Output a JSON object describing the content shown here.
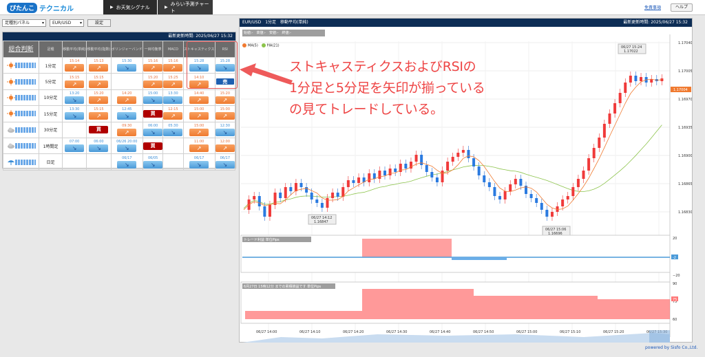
{
  "app": {
    "logo_part1": "ぴたんこ",
    "logo_part2": "テクニカル"
  },
  "nav": {
    "tab1": "お天気シグナル",
    "tab2": "みらい予測チャート",
    "disclaimer": "免責事項",
    "help": "ヘルプ"
  },
  "controls": {
    "type_select": "足種別パネル",
    "pair_select": "EUR/USD",
    "set_button": "設定"
  },
  "left_panel": {
    "updated": "最新更新時間: 2025/06/27 15:32",
    "headers": [
      "総合判断",
      "足種",
      "移動平均(単純)",
      "移動平均(指数)",
      "ボリンジャーバンド",
      "一目均衡表",
      "MACD",
      "ストキャスティクス",
      "RSI"
    ],
    "rows": [
      {
        "label": "1分足",
        "weather": "sun",
        "cells": [
          [
            "15:14",
            "up",
            "o"
          ],
          [
            "15:13",
            "up",
            "o"
          ],
          [
            "15:30",
            "dn",
            "b"
          ],
          [
            "15:16",
            "up",
            "o"
          ],
          [
            "15:16",
            "up",
            "o"
          ],
          [
            "15:28",
            "dn",
            "b"
          ],
          [
            "15:28",
            "dn",
            "b"
          ]
        ]
      },
      {
        "label": "5分足",
        "weather": "sun",
        "cells": [
          [
            "15:15",
            "up",
            "o"
          ],
          [
            "15:15",
            "up",
            "o"
          ],
          [
            "",
            "",
            ""
          ],
          [
            "15:20",
            "up",
            "o"
          ],
          [
            "15:25",
            "up",
            "o"
          ],
          [
            "14:10",
            "up",
            "o"
          ],
          [
            "",
            "sell",
            "b"
          ]
        ]
      },
      {
        "label": "10分足",
        "weather": "sun",
        "cells": [
          [
            "13:20",
            "dn",
            "b"
          ],
          [
            "15:20",
            "up",
            "o"
          ],
          [
            "14:20",
            "up",
            "o"
          ],
          [
            "15:00",
            "dn",
            "b"
          ],
          [
            "13:30",
            "dn",
            "b"
          ],
          [
            "14:40",
            "up",
            "o"
          ],
          [
            "15:20",
            "up",
            "o"
          ]
        ]
      },
      {
        "label": "15分足",
        "weather": "sun",
        "cells": [
          [
            "13:30",
            "dn",
            "b"
          ],
          [
            "15:15",
            "up",
            "o"
          ],
          [
            "12:45",
            "dn",
            "b"
          ],
          [
            "",
            "buy",
            ""
          ],
          [
            "12:15",
            "up",
            "o"
          ],
          [
            "15:00",
            "up",
            "o"
          ],
          [
            "15:00",
            "up",
            "o"
          ]
        ]
      },
      {
        "label": "30分足",
        "weather": "cloud",
        "cells": [
          [
            "",
            "",
            ""
          ],
          [
            "",
            "buy",
            ""
          ],
          [
            "09:30",
            "up",
            "o"
          ],
          [
            "06:00",
            "dn",
            "b"
          ],
          [
            "05:30",
            "dn",
            "b"
          ],
          [
            "15:00",
            "up",
            "o"
          ],
          [
            "12:30",
            "dn",
            "b"
          ]
        ]
      },
      {
        "label": "1時間足",
        "weather": "cloud",
        "cells": [
          [
            "07:00",
            "dn",
            "b"
          ],
          [
            "06:00",
            "dn",
            "b"
          ],
          [
            "06/26 20:00",
            "dn",
            "b"
          ],
          [
            "",
            "buy",
            ""
          ],
          [
            "",
            "",
            ""
          ],
          [
            "11:00",
            "up",
            "o"
          ],
          [
            "12:00",
            "up",
            "o"
          ]
        ]
      },
      {
        "label": "日足",
        "weather": "rain",
        "cells": [
          [
            "",
            "",
            ""
          ],
          [
            "",
            "",
            ""
          ],
          [
            "06/17",
            "dn",
            "b"
          ],
          [
            "06/05",
            "dn",
            "b"
          ],
          [
            "",
            "",
            ""
          ],
          [
            "06/17",
            "dn",
            "b"
          ],
          [
            "06/17",
            "dn",
            "b"
          ]
        ]
      }
    ]
  },
  "labels": {
    "buy": "買",
    "sell": "売",
    "up": "↗",
    "dn": "↘"
  },
  "chart": {
    "header": "EUR/USD　1分足　移動平均(単純)",
    "updated": "最新更新時間: 2025/06/27 15:32",
    "ohlc": "始値:-　高値:-　安値:-　終値:-",
    "ma5": "MA(5)",
    "ma21": "MA(21)",
    "ma5_color": "#f07a30",
    "ma21_color": "#8bc34a",
    "price_ticks": [
      "1.17040",
      "1.17005",
      "1.16970",
      "1.16935",
      "1.16900",
      "1.16865",
      "1.16830"
    ],
    "current_price": "1.17004",
    "annotations": [
      {
        "time": "06/27 15:24",
        "price": "1.17022"
      },
      {
        "time": "06/27 14:12",
        "price": "1.16847"
      },
      {
        "time": "06/27 15:06",
        "price": "1.16696"
      }
    ],
    "sub1_title": "トレード利益 単位Pips",
    "sub1_ticks": [
      "20",
      "0",
      "−20"
    ],
    "sub1_current": "-2",
    "sub2_title": "6月27日 15時12分 までの累積損益です 単位Pips",
    "sub2_ticks": [
      "90",
      "75",
      "60"
    ],
    "sub2_current": "75",
    "x_ticks": [
      "06/27 14:00",
      "06/27 14:10",
      "06/27 14:20",
      "06/27 14:30",
      "06/27 14:40",
      "06/27 14:50",
      "06/27 15:00",
      "06/27 15:10",
      "06/27 15:20",
      "06/27 15:30"
    ]
  },
  "powered_by": "powered by  Sisfo Co.,Ltd.",
  "note": [
    "ストキャスティクスおよびRSIの",
    "1分足と5分足を矢印が揃っている",
    "の見てトレードしている。"
  ]
}
